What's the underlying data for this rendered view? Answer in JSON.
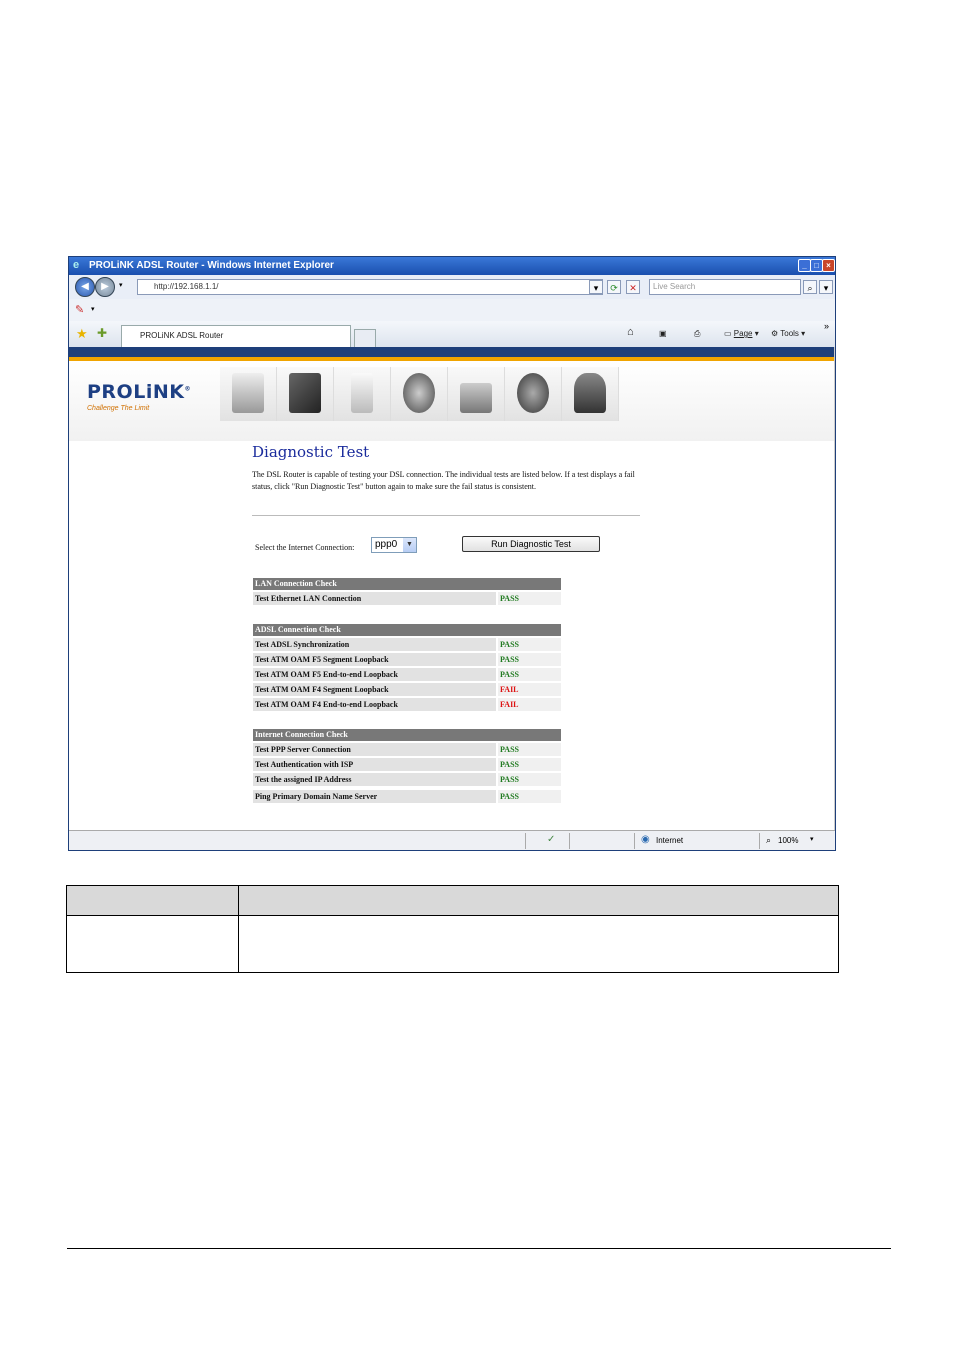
{
  "window": {
    "title": "PROLiNK ADSL Router - Windows Internet Explorer",
    "address": "http://192.168.1.1/",
    "search_placeholder": "Live Search",
    "tab_label": "PROLiNK ADSL Router",
    "cmd_page": "Page",
    "cmd_tools": "Tools"
  },
  "brand": {
    "logo": "PROLiNK",
    "registered": "®",
    "tagline": "Challenge The Limit"
  },
  "nav_icons": [
    "status-icon",
    "advanced-setup-icon",
    "wireless-icon",
    "internet-icon",
    "security-icon",
    "management-icon",
    "user-icon"
  ],
  "page": {
    "title": "Diagnostic Test",
    "description": "The DSL Router is capable of testing your DSL connection. The individual tests are listed below. If a test displays a fail status, click \"Run Diagnostic Test\" button again to make sure the fail status is consistent.",
    "select_label": "Select the Internet Connection:",
    "select_value": "ppp0",
    "run_button": "Run Diagnostic Test"
  },
  "sections": [
    {
      "header": "LAN Connection Check",
      "rows": [
        {
          "name": "Test Ethernet LAN Connection",
          "result": "PASS"
        }
      ]
    },
    {
      "header": "ADSL Connection Check",
      "rows": [
        {
          "name": "Test ADSL Synchronization",
          "result": "PASS"
        },
        {
          "name": "Test ATM OAM F5 Segment Loopback",
          "result": "PASS"
        },
        {
          "name": "Test ATM OAM F5 End-to-end Loopback",
          "result": "PASS"
        },
        {
          "name": "Test ATM OAM F4 Segment Loopback",
          "result": "FAIL"
        },
        {
          "name": "Test ATM OAM F4 End-to-end Loopback",
          "result": "FAIL"
        }
      ]
    },
    {
      "header": "Internet Connection Check",
      "rows": [
        {
          "name": "Test PPP Server Connection",
          "result": "PASS"
        },
        {
          "name": "Test Authentication with ISP",
          "result": "PASS"
        },
        {
          "name": "Test the assigned IP Address",
          "result": "PASS"
        },
        {
          "name": "Ping Primary Domain Name Server",
          "result": "PASS"
        }
      ]
    }
  ],
  "statusbar": {
    "zone": "Internet",
    "zoom": "100%"
  },
  "colors": {
    "pass": "#1f7a1f",
    "fail": "#dd1111",
    "header_blue": "#1e3f7a",
    "accent_orange": "#f0a400"
  }
}
